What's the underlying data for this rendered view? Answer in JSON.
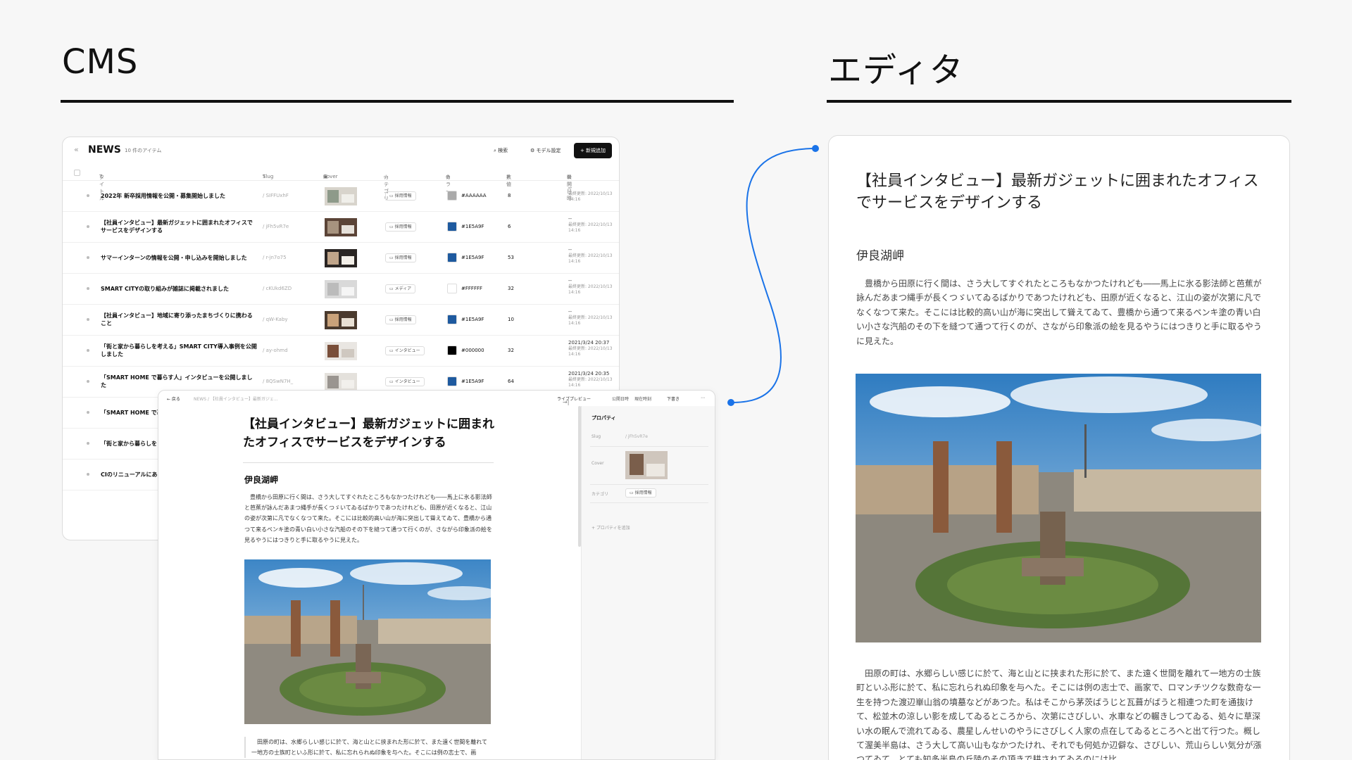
{
  "headings": {
    "cms": "CMS",
    "editor": "エディタ"
  },
  "cms": {
    "collapse_icon": "«",
    "title": "NEWS",
    "count": "10 件のアイテム",
    "search_label": "検索",
    "model_settings_label": "モデル設定",
    "add_button": "新規追加",
    "columns": [
      "タイトル",
      "Slug",
      "Cover",
      "カテゴリ",
      "カラー",
      "数値",
      "公開日時"
    ],
    "rows": [
      {
        "title": "2022年 新卒採用情報を公開・募集開始しました",
        "slug": "/ SIFFUxhF",
        "category": "採用情報",
        "color": "#AAAAAA",
        "number": "8",
        "date1": "--",
        "date2": "最終更新: 2022/10/13",
        "date3": "14:16"
      },
      {
        "title": "【社員インタビュー】最新ガジェットに囲まれたオフィスでサービスをデザインする",
        "slug": "/ jFh5vR7e",
        "category": "採用情報",
        "color": "#1E5A9F",
        "number": "6",
        "date1": "--",
        "date2": "最終更新: 2022/10/13",
        "date3": "14:16"
      },
      {
        "title": "サマーインターンの情報を公開・申し込みを開始しました",
        "slug": "/ r-jn7o75",
        "category": "採用情報",
        "color": "#1E5A9F",
        "number": "53",
        "date1": "--",
        "date2": "最終更新: 2022/10/13",
        "date3": "14:16"
      },
      {
        "title": "SMART CITYの取り組みが雑誌に掲載されました",
        "slug": "/ cKUkd6ZD",
        "category": "メディア",
        "color": "#FFFFFF",
        "number": "32",
        "date1": "--",
        "date2": "最終更新: 2022/10/13",
        "date3": "14:16"
      },
      {
        "title": "【社員インタビュー】地域に寄り添ったまちづくりに携わること",
        "slug": "/ qW-Kaby",
        "category": "採用情報",
        "color": "#1E5A9F",
        "number": "10",
        "date1": "--",
        "date2": "最終更新: 2022/10/13",
        "date3": "14:16"
      },
      {
        "title": "「街と家から暮らしを考える」SMART CITY導入事例を公開しました",
        "slug": "/ ay-ohmd",
        "category": "インタビュー",
        "color": "#000000",
        "number": "32",
        "date1": "2021/3/24 20:37",
        "date2": "最終更新: 2022/10/13",
        "date3": "14:16"
      },
      {
        "title": "「SMART HOME で暮らす人」インタビューを公開しました",
        "slug": "/ 8QSwN7H_",
        "category": "インタビュー",
        "color": "#1E5A9F",
        "number": "64",
        "date1": "2021/3/24 20:35",
        "date2": "最終更新: 2022/10/13",
        "date3": "14:16"
      },
      {
        "title": "「SMART HOME で暮",
        "slug": "",
        "category": "",
        "color": "",
        "number": "",
        "date1": "",
        "date2": "",
        "date3": ""
      },
      {
        "title": "「街と家から暮らしを しました",
        "slug": "",
        "category": "",
        "color": "",
        "number": "",
        "date1": "",
        "date2": "",
        "date3": ""
      },
      {
        "title": "CIのリニューアルにあ ューアルしました",
        "slug": "",
        "category": "",
        "color": "",
        "number": "",
        "date1": "",
        "date2": "",
        "date3": ""
      }
    ]
  },
  "editor_modal": {
    "back_label": "← 戻る",
    "breadcrumb": "NEWS  /  【社員インタビュー】最新ガジェ...",
    "live_preview": "ライブプレビュー",
    "publish_time": "公開日時",
    "current_time": "現在時刻",
    "draft": "下書き",
    "more": "⋯",
    "title": "【社員インタビュー】最新ガジェットに囲まれたオフィスでサービスをデザインする",
    "subheading": "伊良湖岬",
    "paragraph1": "豊橋から田原に行く間は、さう大してすぐれたところもなかつたけれども――馬上に氷る影法師と芭蕉が詠んだあまつ縄手が長くつゞいてゐるばかりであつたけれども、田原が近くなると、江山の姿が次第に凡でなくなつて来た。そこには比較的高い山が海に突出して聳えてゐて、豊橋から通つて来るペンキ塗の青い白い小さな汽船のその下を縫つて通つて行くのが、さながら印象派の絵を見るやうにはつきりと手に取るやうに見えた。",
    "paragraph2": "田原の町は、水郷らしい感じに於て、海と山とに挟まれた形に於て、また遠く世間を離れて一地方の士族町といふ形に於て、私に忘れられぬ印象を与へた。そこには例の志士で、画",
    "properties": {
      "title": "プロパティ",
      "slug_key": "Slug",
      "slug_value": "/ jFh5vR7e",
      "cover_key": "Cover",
      "category_key": "カテゴリ",
      "category_value": "採用情報",
      "add_property": "+ プロパティを追加"
    }
  },
  "preview": {
    "title": "【社員インタビュー】最新ガジェットに囲まれたオフィスでサービスをデザインする",
    "subheading": "伊良湖岬",
    "paragraph1": "豊橋から田原に行く間は、さう大してすぐれたところもなかつたけれども――馬上に氷る影法師と芭蕉が詠んだあまつ縄手が長くつゞいてゐるばかりであつたけれども、田原が近くなると、江山の姿が次第に凡でなくなつて来た。そこには比較的高い山が海に突出して聳えてゐて、豊橋から通つて来るペンキ塗の青い白い小さな汽船のその下を縫つて通つて行くのが、さながら印象派の絵を見るやうにはつきりと手に取るやうに見えた。",
    "paragraph2": "田原の町は、水郷らしい感じに於て、海と山とに挟まれた形に於て、また遠く世間を離れて一地方の士族町といふ形に於て、私に忘れられぬ印象を与へた。そこには例の志士で、画家で、ロマンチツクな数奇な一生を持つた渡辺崋山翁の墳墓などがあつた。私はそこから茅茨ばうじと瓦葺がばうと相連つた町を通抜けて、松並木の涼しい影を成してゐるところから、次第にさびしい、水車などの輾きしつてゐる、処々に草深い水の眠んで流れてゐる、農星しんせいのやうにさびしく人家の点在してゐるところへと出て行つた。概して渥美半島は、さう大して高い山もなかつたけれ、それでも何処か辺僻な、さびしい、荒山らしい気分が漲つてゐて、とても知多半島の丘陵のその頂きで耕されてゐるのには比"
  },
  "colors": {
    "accent": "#1a73e8",
    "ink": "#111111"
  },
  "icons": {
    "search": "search-icon",
    "gear": "gear-icon",
    "plus": "plus-icon",
    "text": "text-type-icon",
    "image": "image-icon",
    "folder": "folder-icon",
    "palette": "palette-icon",
    "hash": "hash-icon",
    "calendar": "calendar-icon"
  }
}
